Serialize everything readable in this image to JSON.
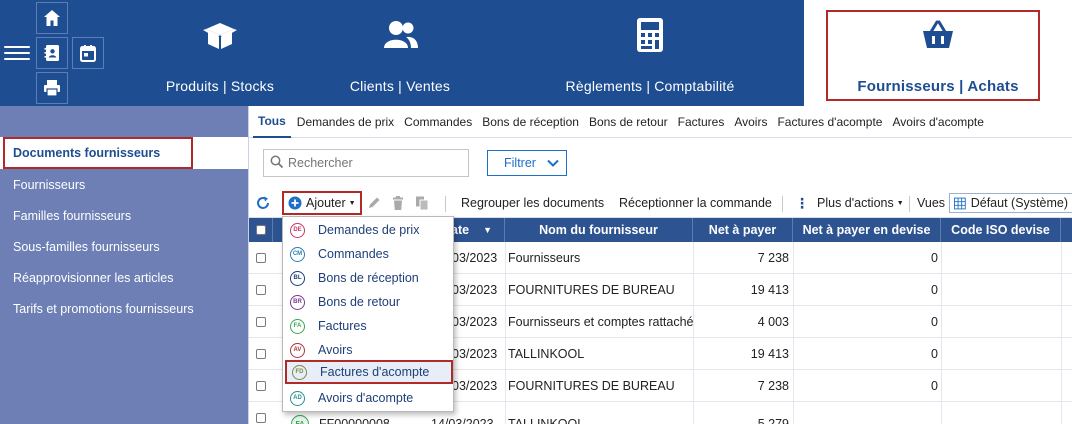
{
  "modules": [
    {
      "label": "Produits | Stocks",
      "icon": "box-icon"
    },
    {
      "label": "Clients | Ventes",
      "icon": "users-icon"
    },
    {
      "label": "Règlements | Comptabilité",
      "icon": "calculator-icon"
    },
    {
      "label": "Fournisseurs | Achats",
      "icon": "basket-icon",
      "active": true
    }
  ],
  "sidebar": {
    "items": [
      {
        "label": "Documents fournisseurs",
        "active": true
      },
      {
        "label": "Fournisseurs"
      },
      {
        "label": "Familles fournisseurs"
      },
      {
        "label": "Sous-familles fournisseurs"
      },
      {
        "label": "Réapprovisionner les articles"
      },
      {
        "label": "Tarifs et promotions fournisseurs"
      }
    ]
  },
  "tabs": [
    "Tous",
    "Demandes de prix",
    "Commandes",
    "Bons de réception",
    "Bons de retour",
    "Factures",
    "Avoirs",
    "Factures d'acompte",
    "Avoirs d'acompte"
  ],
  "search": {
    "placeholder": "Rechercher"
  },
  "filter_label": "Filtrer",
  "toolbar": {
    "add_label": "Ajouter",
    "group_label": "Regrouper les documents",
    "receive_label": "Réceptionner la commande",
    "more_label": "Plus d'actions",
    "views_label": "Vues",
    "view_value": "Défaut (Système)"
  },
  "table": {
    "columns": [
      "Date",
      "Nom du fournisseur",
      "Net à payer",
      "Net à payer en devise",
      "Code ISO devise"
    ],
    "rows": [
      {
        "date_visible": "03/2023",
        "supplier": "Fournisseurs",
        "net": "7 238",
        "net_currency": "0"
      },
      {
        "date_visible": "03/2023",
        "supplier": "FOURNITURES DE BUREAU",
        "net": "19 413",
        "net_currency": "0"
      },
      {
        "date_visible": "03/2023",
        "supplier": "Fournisseurs et comptes rattachés",
        "net": "4 003",
        "net_currency": "0"
      },
      {
        "date_visible": "03/2023",
        "supplier": "TALLINKOOL",
        "net": "19 413",
        "net_currency": "0"
      },
      {
        "date_visible": "03/2023",
        "supplier": "FOURNITURES DE BUREAU",
        "net": "7 238",
        "net_currency": "0"
      },
      {
        "badge": "FA",
        "number": "FF00000008",
        "date_visible": "14/03/2023",
        "supplier": "TALLINKOOL",
        "net": "5 279",
        "net_currency": ""
      }
    ]
  },
  "add_menu": {
    "items": [
      {
        "code": "DE",
        "label": "Demandes de prix",
        "color": "#c0396b"
      },
      {
        "code": "CM",
        "label": "Commandes",
        "color": "#2a7fb0"
      },
      {
        "code": "BL",
        "label": "Bons de réception",
        "color": "#1b3f7a"
      },
      {
        "code": "BR",
        "label": "Bons de retour",
        "color": "#7a3a8a"
      },
      {
        "code": "FA",
        "label": "Factures",
        "color": "#3aa653"
      },
      {
        "code": "AV",
        "label": "Avoirs",
        "color": "#b0323a"
      },
      {
        "code": "FD",
        "label": "Factures d'acompte",
        "color": "#7b8a3a",
        "highlighted": true
      },
      {
        "code": "AD",
        "label": "Avoirs d'acompte",
        "color": "#2a8f8f"
      }
    ]
  },
  "colors": {
    "brand": "#1e4d91",
    "sidebar": "#6d7fb5",
    "highlight_frame": "#b02a2a"
  }
}
